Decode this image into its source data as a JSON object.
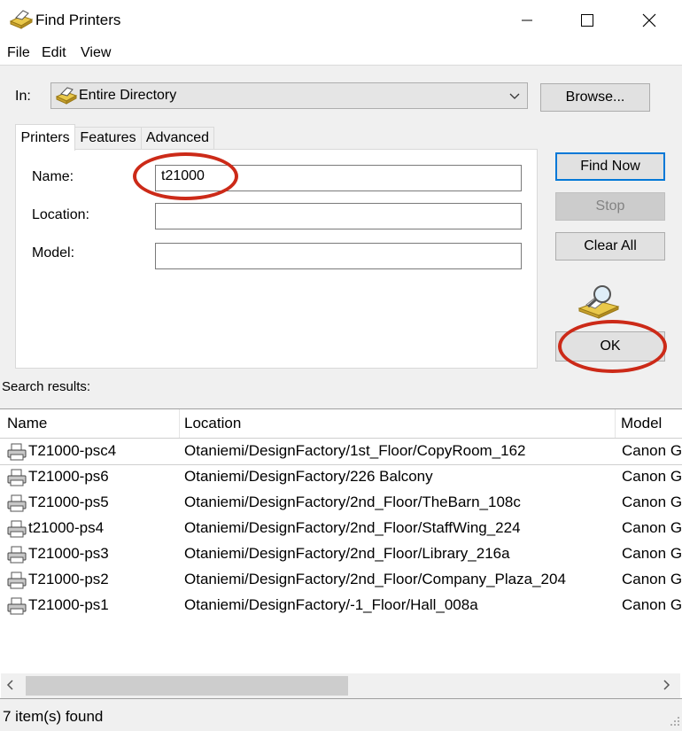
{
  "window": {
    "title": "Find Printers",
    "icon": "printer-folder-icon"
  },
  "menu": {
    "file": "File",
    "edit": "Edit",
    "view": "View"
  },
  "search_scope": {
    "label": "In:",
    "value": "Entire Directory",
    "browse_label": "Browse..."
  },
  "tabs": {
    "printers": "Printers",
    "features": "Features",
    "advanced": "Advanced"
  },
  "form": {
    "name_label": "Name:",
    "name_value": "t21000",
    "location_label": "Location:",
    "location_value": "",
    "model_label": "Model:",
    "model_value": ""
  },
  "actions": {
    "find_now": "Find Now",
    "stop": "Stop",
    "clear_all": "Clear All",
    "ok": "OK"
  },
  "results": {
    "label": "Search results:",
    "columns": {
      "name": "Name",
      "location": "Location",
      "model": "Model"
    },
    "rows": [
      {
        "name": "T21000-psc4",
        "location": "Otaniemi/DesignFactory/1st_Floor/CopyRoom_162",
        "model": "Canon G"
      },
      {
        "name": "T21000-ps6",
        "location": "Otaniemi/DesignFactory/226 Balcony",
        "model": "Canon G"
      },
      {
        "name": "T21000-ps5",
        "location": "Otaniemi/DesignFactory/2nd_Floor/TheBarn_108c",
        "model": "Canon G"
      },
      {
        "name": "t21000-ps4",
        "location": "Otaniemi/DesignFactory/2nd_Floor/StaffWing_224",
        "model": "Canon G"
      },
      {
        "name": "T21000-ps3",
        "location": "Otaniemi/DesignFactory/2nd_Floor/Library_216a",
        "model": "Canon G"
      },
      {
        "name": "T21000-ps2",
        "location": "Otaniemi/DesignFactory/2nd_Floor/Company_Plaza_204",
        "model": "Canon G"
      },
      {
        "name": "T21000-ps1",
        "location": "Otaniemi/DesignFactory/-1_Floor/Hall_008a",
        "model": "Canon G"
      }
    ]
  },
  "status": {
    "text": "7 item(s) found"
  },
  "colors": {
    "annotation": "#cc2a18",
    "accent": "#0078d7"
  }
}
